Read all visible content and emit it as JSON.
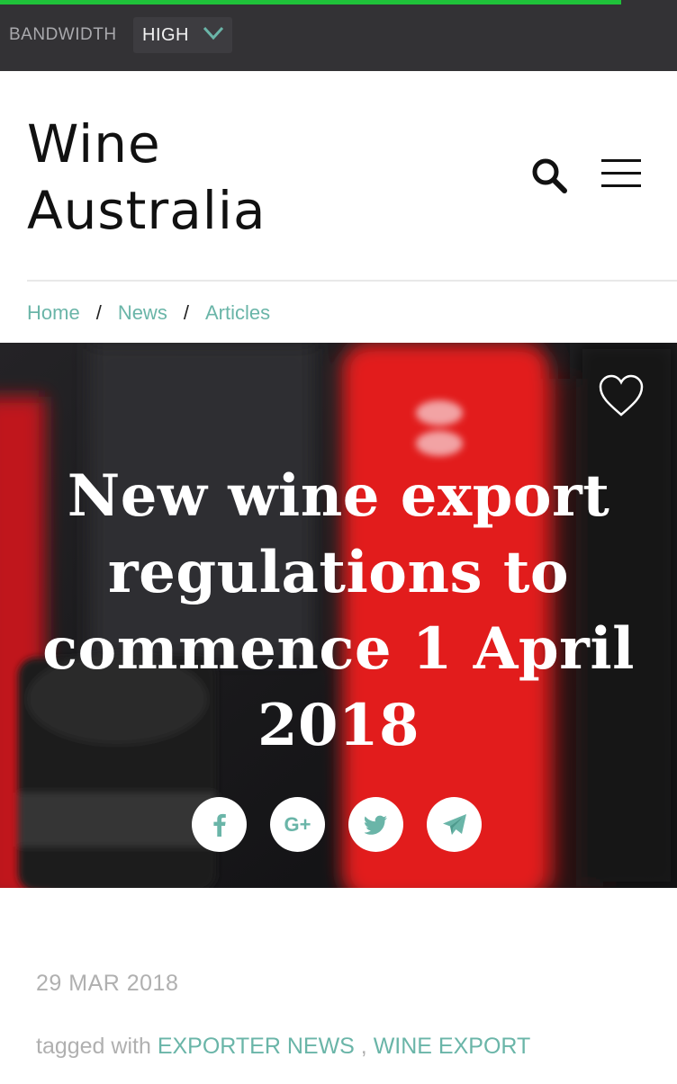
{
  "topbar": {
    "bandwidth_label": "BANDWIDTH",
    "bandwidth_value": "HIGH",
    "progress_color": "#1fc23a"
  },
  "header": {
    "logo_line1": "Wine",
    "logo_line2": "Australia",
    "search_icon": "search-icon",
    "menu_icon": "hamburger-menu-icon"
  },
  "breadcrumb": {
    "items": [
      "Home",
      "News",
      "Articles"
    ],
    "separator": "/"
  },
  "hero": {
    "title": "New wine export regulations to commence 1 April 2018",
    "favorite_icon": "heart-icon",
    "share": [
      "facebook-icon",
      "google-plus-icon",
      "twitter-icon",
      "telegram-icon"
    ],
    "share_labels": {
      "google_plus": "G+"
    }
  },
  "article": {
    "date": "29 MAR 2018",
    "tagged_prefix": "tagged with",
    "tags": [
      "EXPORTER NEWS",
      "WINE EXPORT REGULATIONS"
    ],
    "tag_separator": " , "
  },
  "colors": {
    "accent": "#6ab5a8",
    "topbar_bg": "#333235"
  }
}
